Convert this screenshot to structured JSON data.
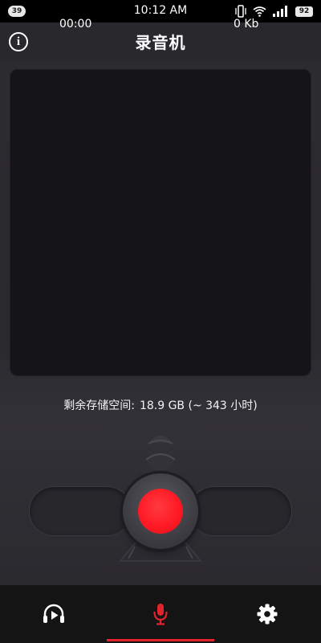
{
  "status_bar": {
    "notification_count": "39",
    "time": "10:12 AM",
    "battery": "92",
    "icons": [
      "vibrate-icon",
      "wifi-icon",
      "signal-icon",
      "battery-icon"
    ]
  },
  "header": {
    "title": "录音机",
    "info_icon": "info-icon"
  },
  "storage": {
    "label": "剩余存储空间:",
    "value": "18.9 GB (~ 343 小时)"
  },
  "recorder": {
    "elapsed_time": "00:00",
    "file_size": "0 Kb",
    "record_button_color": "#ff1a24"
  },
  "bottom_nav": {
    "tabs": [
      {
        "icon": "play-headphones-icon",
        "active": false
      },
      {
        "icon": "microphone-icon",
        "active": true
      },
      {
        "icon": "gear-icon",
        "active": false
      }
    ],
    "active_color": "#e3232b"
  }
}
